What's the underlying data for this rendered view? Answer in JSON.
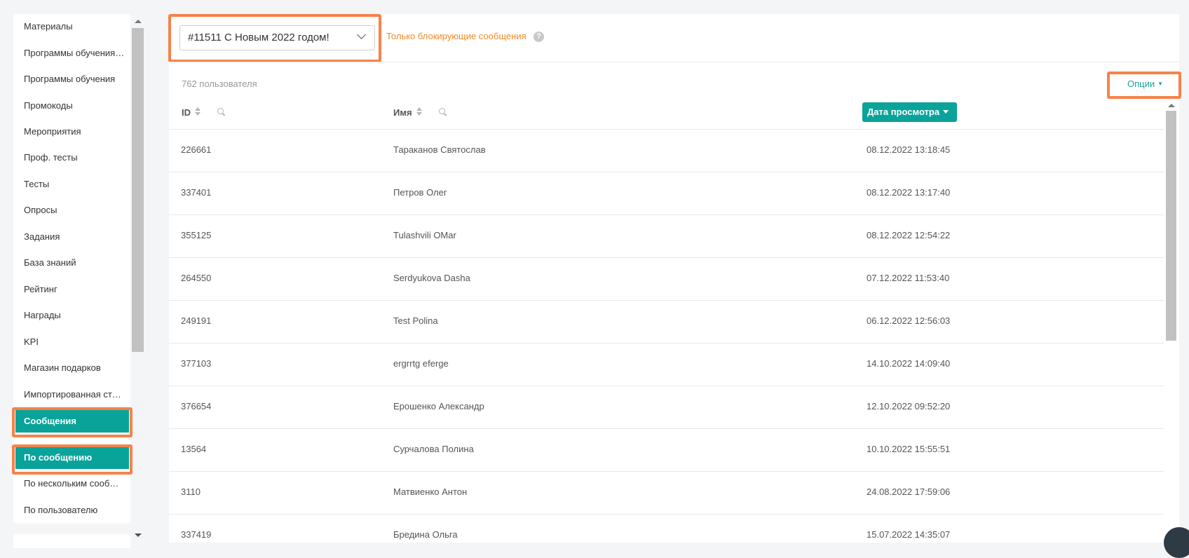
{
  "sidebar": {
    "items": [
      {
        "label": "Материалы"
      },
      {
        "label": "Программы обучения с модулями"
      },
      {
        "label": "Программы обучения"
      },
      {
        "label": "Промокоды"
      },
      {
        "label": "Мероприятия"
      },
      {
        "label": "Проф. тесты"
      },
      {
        "label": "Тесты"
      },
      {
        "label": "Опросы"
      },
      {
        "label": "Задания"
      },
      {
        "label": "База знаний"
      },
      {
        "label": "Рейтинг"
      },
      {
        "label": "Награды"
      },
      {
        "label": "KPI"
      },
      {
        "label": "Магазин подарков"
      },
      {
        "label": "Импортированная статистика"
      },
      {
        "label": "Сообщения"
      },
      {
        "label": "По сообщению"
      },
      {
        "label": "По нескольким сообщениям"
      },
      {
        "label": "По пользователю"
      }
    ]
  },
  "header": {
    "message_select_value": "#11511 С Новым 2022 годом!",
    "blocking_only_link": "Только блокирующие сообщения",
    "help_glyph": "?"
  },
  "table": {
    "user_count": "762 пользователя",
    "options_label": "Опции",
    "columns": {
      "id": "ID",
      "name": "Имя",
      "view_date": "Дата просмотра"
    },
    "rows": [
      {
        "id": "226661",
        "name": "Тараканов Святослав",
        "date": "08.12.2022 13:18:45"
      },
      {
        "id": "337401",
        "name": "Петров Олег",
        "date": "08.12.2022 13:17:40"
      },
      {
        "id": "355125",
        "name": "Tulashvili OMar",
        "date": "08.12.2022 12:54:22"
      },
      {
        "id": "264550",
        "name": "Serdyukova Dasha",
        "date": "07.12.2022 11:53:40"
      },
      {
        "id": "249191",
        "name": "Test Polina",
        "date": "06.12.2022 12:56:03"
      },
      {
        "id": "377103",
        "name": "ergrrtg eferge",
        "date": "14.10.2022 14:09:40"
      },
      {
        "id": "376654",
        "name": "Ерошенко Александр",
        "date": "12.10.2022 09:52:20"
      },
      {
        "id": "13564",
        "name": "Сурчалова Полина",
        "date": "10.10.2022 15:55:51"
      },
      {
        "id": "3110",
        "name": "Матвиенко Антон",
        "date": "24.08.2022 17:59:06"
      },
      {
        "id": "337419",
        "name": "Бредина Ольга",
        "date": "15.07.2022 14:35:07"
      }
    ]
  },
  "colors": {
    "accent": "#0aa39a",
    "highlight": "#f6824a",
    "link_orange": "#f08a24"
  }
}
